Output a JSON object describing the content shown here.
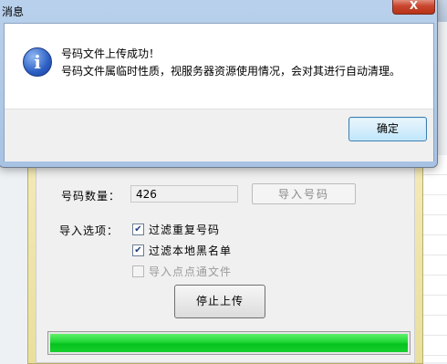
{
  "message_box": {
    "title": "消息",
    "close_label": "X",
    "icon": "info-icon",
    "line1": "号码文件上传成功！",
    "line2": "号码文件属临时性质，视服务器资源使用情况，会对其进行自动清理。",
    "ok_label": "确定"
  },
  "import_dialog": {
    "count_label": "号码数量：",
    "count_value": "426",
    "import_button": "导入号码",
    "options_label": "导入选项：",
    "options": [
      {
        "label": "过滤重复号码",
        "checked": true,
        "enabled": true
      },
      {
        "label": "过滤本地黑名单",
        "checked": true,
        "enabled": true
      },
      {
        "label": "导入点点通文件",
        "checked": false,
        "enabled": false
      }
    ],
    "stop_button": "停止上传",
    "progress": 1.0,
    "progress_color": "#1fd636"
  }
}
